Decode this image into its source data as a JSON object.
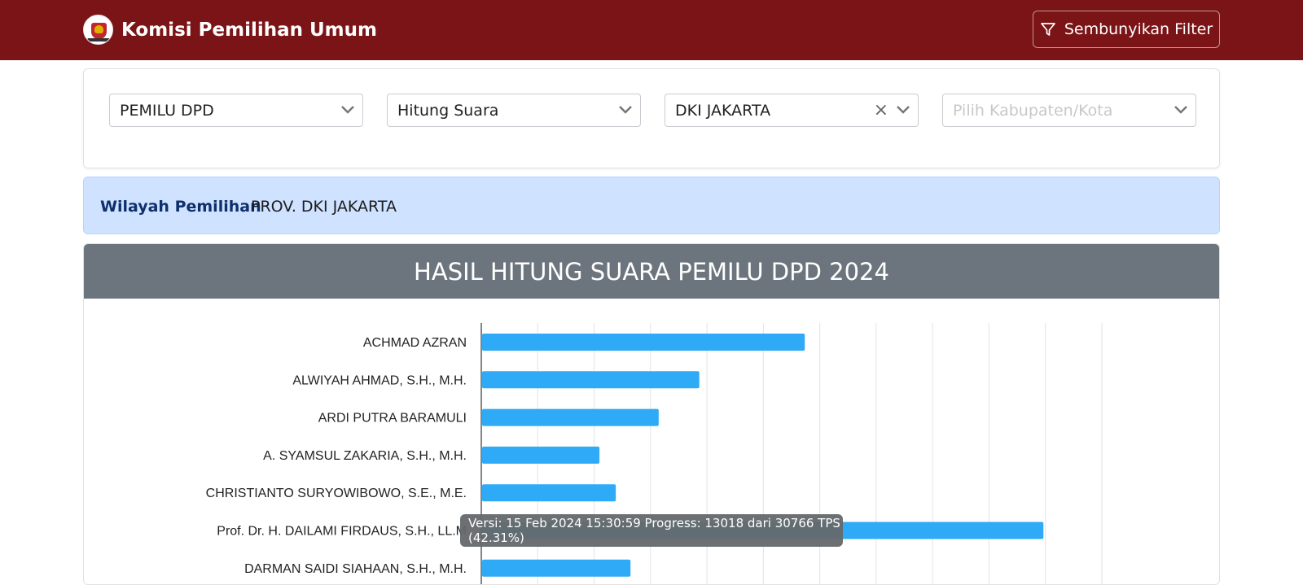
{
  "brand": {
    "title": "Komisi Pemilihan Umum",
    "logo_icon": "kpu-logo"
  },
  "navbar": {
    "filter_button_label": "Sembunyikan Filter",
    "filter_icon": "funnel-icon",
    "color": "#7b1416"
  },
  "filters": {
    "election": {
      "value": "PEMILU DPD"
    },
    "mode": {
      "value": "Hitung Suara"
    },
    "province": {
      "value": "DKI JAKARTA"
    },
    "city": {
      "placeholder": "Pilih Kabupaten/Kota"
    }
  },
  "region": {
    "label": "Wilayah Pemilihan",
    "value": "PROV. DKI JAKARTA"
  },
  "chart_title": "HASIL HITUNG SUARA PEMILU DPD 2024",
  "tooltip": {
    "text": "Versi: 15 Feb 2024 15:30:59 Progress: 13018 dari 30766 TPS (42.31%)"
  },
  "chart_data": {
    "type": "bar",
    "orientation": "horizontal",
    "categories": [
      "ACHMAD AZRAN",
      "ALWIYAH AHMAD, S.H., M.H.",
      "ARDI PUTRA BARAMULI",
      "A. SYAMSUL ZAKARIA, S.H., M.H.",
      "CHRISTIANTO SURYOWIBOWO, S.E., M.E.",
      "Prof. Dr. H. DAILAMI FIRDAUS, S.H., LL.M",
      "DARMAN SAIDI SIAHAAN, S.H., M.H."
    ],
    "values": [
      5.72,
      3.85,
      3.13,
      2.08,
      2.37,
      9.95,
      2.63
    ],
    "xlim": [
      0,
      11
    ],
    "grid": true,
    "bar_color": "#2eaaf7"
  }
}
